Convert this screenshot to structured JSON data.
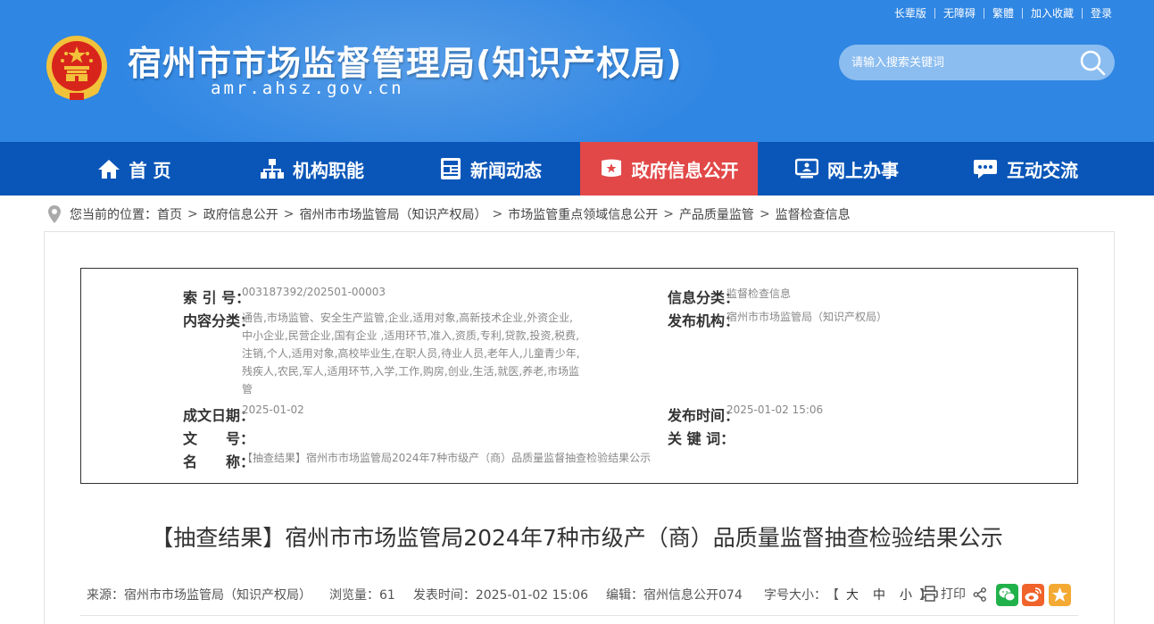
{
  "top_links": [
    "长辈版",
    "无障碍",
    "繁體",
    "加入收藏",
    "登录"
  ],
  "site": {
    "title": "宿州市市场监督管理局(知识产权局)",
    "domain": "amr.ahsz.gov.cn"
  },
  "search": {
    "placeholder": "请输入搜索关键词"
  },
  "nav": [
    {
      "label": "首 页",
      "icon": "home-icon"
    },
    {
      "label": "机构职能",
      "icon": "org-chart-icon"
    },
    {
      "label": "新闻动态",
      "icon": "newspaper-icon"
    },
    {
      "label": "政府信息公开",
      "icon": "info-disclosure-icon",
      "active": true
    },
    {
      "label": "网上办事",
      "icon": "monitor-icon"
    },
    {
      "label": "互动交流",
      "icon": "chat-icon"
    }
  ],
  "breadcrumb": {
    "prefix": "您当前的位置：",
    "items": [
      "首页",
      "政府信息公开",
      "宿州市市场监管局（知识产权局）",
      "市场监管重点领域信息公开",
      "产品质量监管",
      "监督检查信息"
    ]
  },
  "info": {
    "index_label": "索 引 号：",
    "index_value": "003187392/202501-00003",
    "category_label": "信息分类：",
    "category_value": "监督检查信息",
    "content_label": "内容分类：",
    "content_lines": [
      "通告,市场监管、安全生产监管,企业,适用对象,高新技术企业,外资企业,",
      "中小企业,民营企业,国有企业 ,适用环节,准入,资质,专利,贷款,投资,税费,",
      "注销,个人,适用对象,高校毕业生,在职人员,待业人员,老年人,儿童青少年,",
      "残疾人,农民,军人,适用环节,入学,工作,购房,创业,生活,就医,养老,市场监",
      "管"
    ],
    "publisher_label": "发布机构：",
    "publisher_value": "宿州市市场监管局（知识产权局）",
    "date_label": "成文日期：",
    "date_value": "2025-01-02",
    "pubtime_label": "发布时间：",
    "pubtime_value": "2025-01-02 15:06",
    "docno_label": "文　　号：",
    "docno_value": "",
    "keywords_label": "关 键 词：",
    "keywords_value": "",
    "name_label": "名　　称：",
    "name_value": "【抽查结果】宿州市市场监管局2024年7种市级产（商）品质量监督抽查检验结果公示"
  },
  "article": {
    "title": "【抽查结果】宿州市市场监管局2024年7种市级产（商）品质量监督抽查检验结果公示",
    "source": "来源：宿州市市场监管局（知识产权局）",
    "views": "浏览量：61",
    "pubtime": "发表时间：2025-01-02 15:06",
    "editor": "编辑：宿州信息公开074",
    "font_size_label": "字号大小：",
    "font_bracket_open": "【",
    "font_large": "大",
    "font_medium": "中",
    "font_small": "小",
    "font_bracket_close": "】",
    "print_label": "打印"
  },
  "colors": {
    "header_bg": "#2f86e3",
    "nav_bg": "#0a56b8",
    "nav_active": "#e24848",
    "wechat": "#20b14b",
    "weibo": "#f0632a",
    "favorite": "#f4a933"
  }
}
